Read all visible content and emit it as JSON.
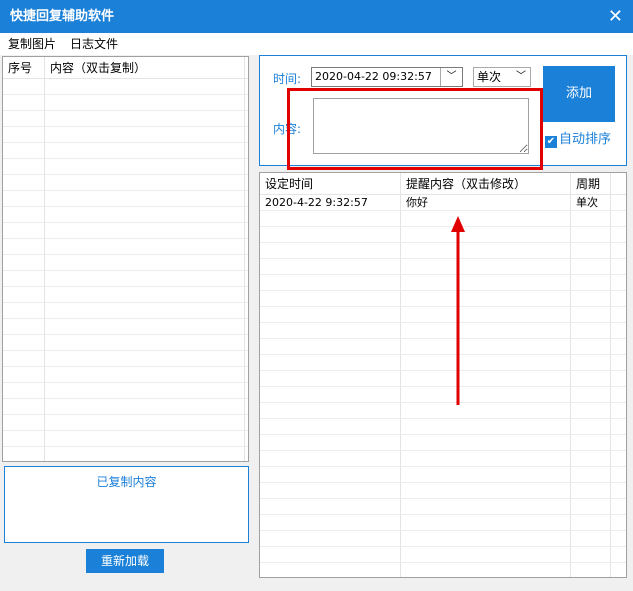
{
  "window": {
    "title": "快捷回复辅助软件",
    "close_icon": "close-icon"
  },
  "menu": [
    "复制图片",
    "日志文件"
  ],
  "left_table": {
    "columns": [
      "序号",
      "内容（双击复制）"
    ],
    "rows": []
  },
  "copied_box": {
    "label": "已复制内容"
  },
  "reload_button": "重新加载",
  "form": {
    "time_label": "时间:",
    "time_value": "2020-04-22 09:32:57",
    "cycle_value": "单次",
    "content_label": "内容:",
    "content_value": "",
    "add_button": "添加",
    "auto_sort_label": "自动排序",
    "auto_sort_checked": true
  },
  "right_table": {
    "columns": [
      "设定时间",
      "提醒内容（双击修改）",
      "周期"
    ],
    "rows": [
      [
        "2020-4-22 9:32:57",
        "你好",
        "单次"
      ]
    ]
  },
  "colors": {
    "accent": "#1b80d8",
    "annotation": "#e00000"
  }
}
